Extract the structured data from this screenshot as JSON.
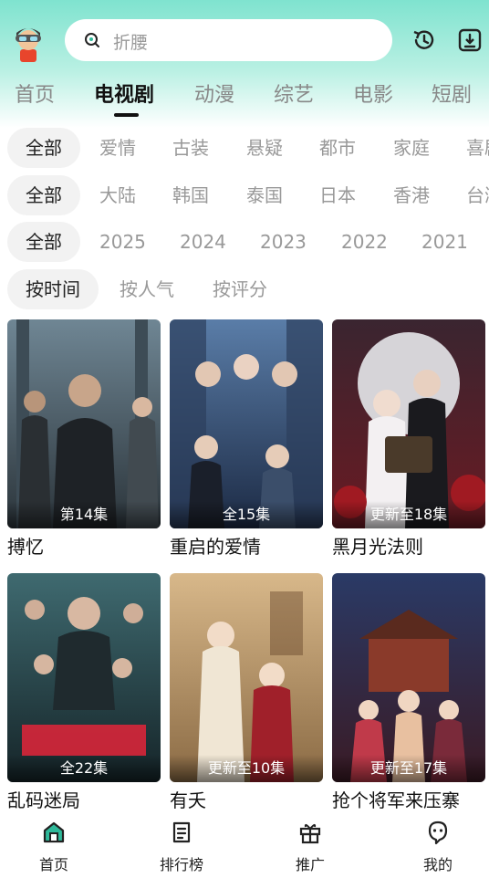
{
  "search": {
    "placeholder": "折腰"
  },
  "tabs": [
    "首页",
    "电视剧",
    "动漫",
    "综艺",
    "电影",
    "短剧"
  ],
  "active_tab": "电视剧",
  "filters": {
    "genre": [
      "全部",
      "爱情",
      "古装",
      "悬疑",
      "都市",
      "家庭",
      "喜剧"
    ],
    "region": [
      "全部",
      "大陆",
      "韩国",
      "泰国",
      "日本",
      "香港",
      "台湾"
    ],
    "year": [
      "全部",
      "2025",
      "2024",
      "2023",
      "2022",
      "2021"
    ],
    "sort": [
      "按时间",
      "按人气",
      "按评分"
    ]
  },
  "shows": [
    {
      "title": "搏忆",
      "episodes": "第14集",
      "poster_color": "#4a5a66"
    },
    {
      "title": "重启的爱情",
      "episodes": "全15集",
      "poster_color": "#3c4e6a"
    },
    {
      "title": "黑月光法则",
      "episodes": "更新至18集",
      "poster_color": "#5a1e26"
    },
    {
      "title": "乱码迷局",
      "episodes": "全22集",
      "poster_color": "#2a4a52"
    },
    {
      "title": "有夭",
      "episodes": "更新至10集",
      "poster_color": "#b08a5a"
    },
    {
      "title": "抢个将军来压寨",
      "episodes": "更新至17集",
      "poster_color": "#2b2a4e"
    }
  ],
  "bottom_nav": [
    "首页",
    "排行榜",
    "推广",
    "我的"
  ],
  "colors": {
    "accent": "#2fb99a",
    "header_gradient_top": "#7fe3cf"
  }
}
